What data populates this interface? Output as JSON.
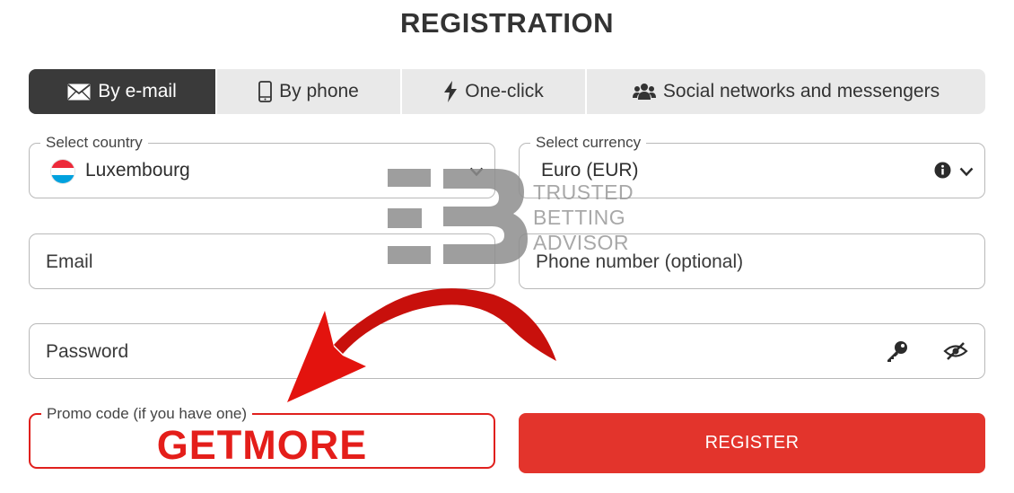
{
  "page": {
    "title": "REGISTRATION"
  },
  "tabs": [
    {
      "label": "By e-mail",
      "icon": "envelope-icon",
      "active": true
    },
    {
      "label": "By phone",
      "icon": "phone-icon",
      "active": false
    },
    {
      "label": "One-click",
      "icon": "lightning-icon",
      "active": false
    },
    {
      "label": "Social networks and messengers",
      "icon": "users-icon",
      "active": false
    }
  ],
  "form": {
    "country": {
      "label": "Select country",
      "value": "Luxembourg",
      "flag_colors": [
        "#ed2939",
        "#ffffff",
        "#00a1de"
      ]
    },
    "currency": {
      "label": "Select currency",
      "value": "Euro (EUR)"
    },
    "email": {
      "placeholder": "Email"
    },
    "phone": {
      "placeholder": "Phone number (optional)"
    },
    "password": {
      "placeholder": "Password"
    },
    "promo": {
      "label": "Promo code (if you have one)",
      "value": "GETMORE"
    },
    "register_label": "REGISTER"
  },
  "watermark": {
    "line1": "TRUSTED",
    "line2": "BETTING",
    "line3": "ADVISOR"
  },
  "colors": {
    "accent": "#e3342c",
    "promo_red": "#e41e1a",
    "tab_active": "#3a3a3a",
    "tab_bg": "#e9e9e9",
    "border": "#b9b9b9"
  }
}
